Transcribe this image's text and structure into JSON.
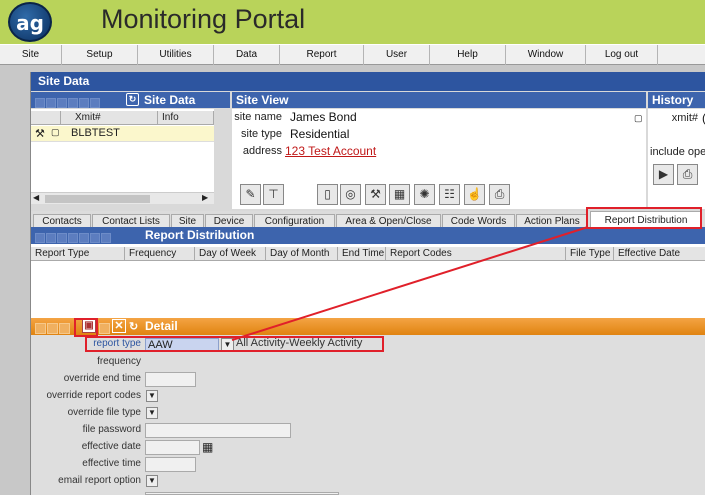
{
  "app": {
    "logo": "ag",
    "title": "Monitoring Portal"
  },
  "menu": [
    "Site",
    "Setup",
    "Utilities",
    "Data",
    "Report",
    "User",
    "Help",
    "Window",
    "Log out"
  ],
  "window": {
    "title": "Site Data"
  },
  "site_list": {
    "header": "Site Data",
    "columns": [
      "Xmit#",
      "Info"
    ],
    "rows": [
      {
        "xmit": "BLBTEST"
      }
    ]
  },
  "site_view": {
    "header": "Site View",
    "site_name_label": "site name",
    "site_name": "James Bond",
    "site_type_label": "site type",
    "site_type": "Residential",
    "address_label": "address",
    "address": "123 Test Account"
  },
  "history": {
    "header": "History",
    "xmit_label": "xmit#",
    "xmit_value": "(",
    "include_label": "include ope"
  },
  "tabs": [
    "Contacts",
    "Contact Lists",
    "Site",
    "Device",
    "Configuration",
    "Area & Open/Close",
    "Code Words",
    "Action Plans",
    "Report Distribution"
  ],
  "report_distribution": {
    "header": "Report Distribution",
    "columns": [
      "Report Type",
      "Frequency",
      "Day of Week",
      "Day of Month",
      "End Time",
      "Report Codes",
      "File Type",
      "Effective Date"
    ]
  },
  "detail": {
    "header": "Detail",
    "report_type_label": "report type",
    "report_type_code": "AAW",
    "report_type_desc": "All Activity-Weekly Activity",
    "labels": {
      "frequency": "frequency",
      "override_end_time": "override end time",
      "override_report_codes": "override report codes",
      "override_file_type": "override file type",
      "file_password": "file password",
      "effective_date": "effective date",
      "effective_time": "effective time",
      "email_report_option": "email report option"
    }
  },
  "colors": {
    "header_green": "#b9d35a",
    "title_blue": "#2d55a0",
    "detail_orange": "#e08310",
    "highlight": "#e0202a"
  }
}
